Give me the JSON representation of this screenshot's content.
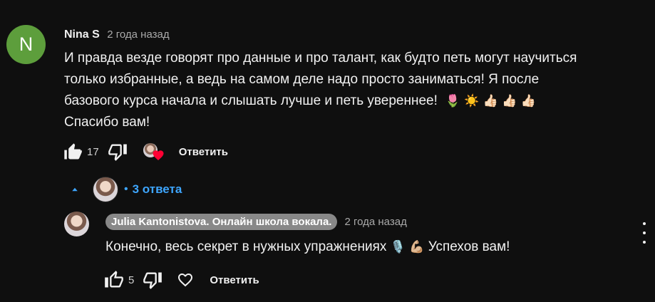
{
  "comment": {
    "avatar_letter": "N",
    "avatar_color": "#5d9e3c",
    "author": "Nina S",
    "timestamp": "2 года назад",
    "text_lines": [
      "И правда везде говорят про данные и про талант, как будто петь могут научиться",
      "только избранные, а ведь на самом деле надо просто заниматься! Я после",
      "базового курса начала и слышать лучше и петь увереннее!",
      "Спасибо вам!"
    ],
    "emojis": "🌷 ☀️ 👍🏻 👍🏻 👍🏻",
    "like_count": "17",
    "reply_label": "Ответить",
    "icons": [
      "thumb-up-icon",
      "thumb-down-icon",
      "creator-heart-icon"
    ]
  },
  "replies_toggle": {
    "label": "3 ответа",
    "accent_color": "#3ea6ff",
    "icon": "chevron-up-icon"
  },
  "reply": {
    "author": "Julia Kantonistova. Онлайн школа вокала.",
    "timestamp": "2 года назад",
    "text": "Конечно, весь секрет в нужных упражнениях",
    "text_tail": "Успехов вам!",
    "emojis": "🎙️ 💪🏼",
    "like_count": "5",
    "reply_label": "Ответить",
    "icons": [
      "thumb-up-icon",
      "thumb-down-icon",
      "heart-outline-icon",
      "more-vert-icon"
    ]
  }
}
